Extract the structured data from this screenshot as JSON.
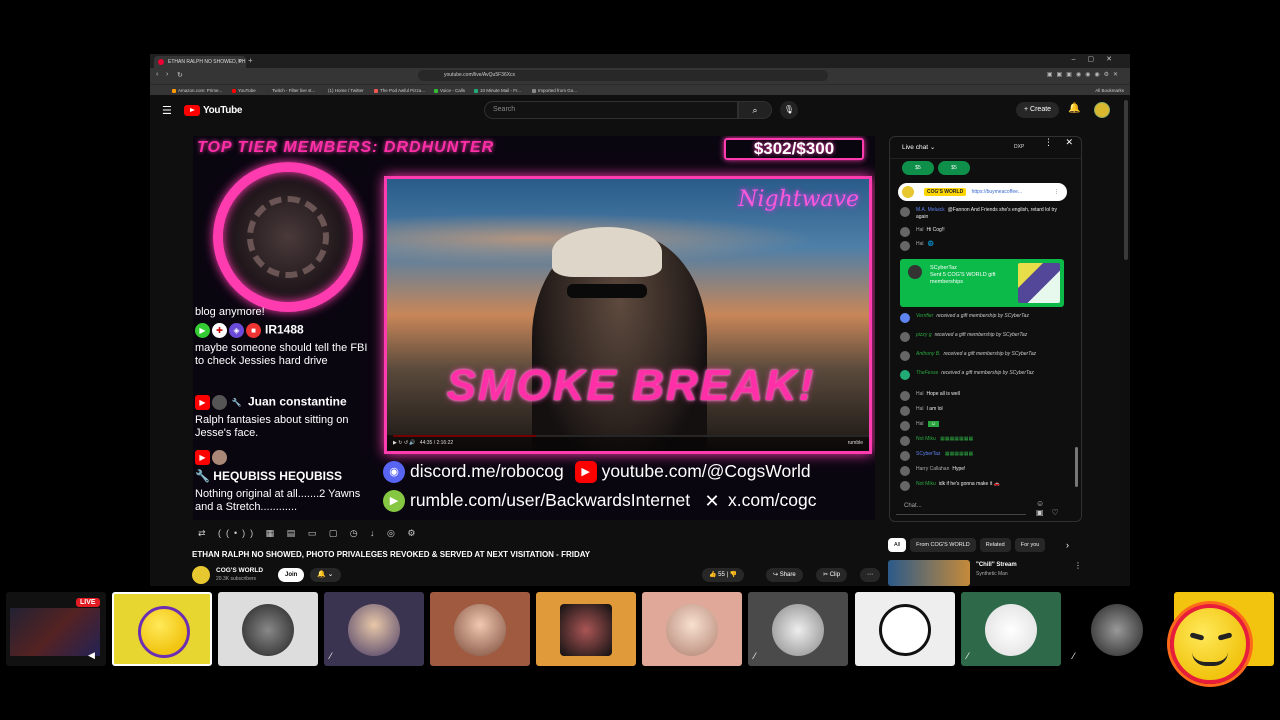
{
  "browser": {
    "tab_title": "ETHAN RALPH NO SHOWED, PH",
    "url": "youtube.com/live/AvQu5F36Xcs",
    "bookmarks": [
      "Amazon.com: Prime...",
      "YouTube",
      "Twitch - Filter live st...",
      "(1) Home / Twitter",
      "The Pod Awful Pizza...",
      "Voice - Calls",
      "10 Minute Mail - Fr...",
      "Imported from Go..."
    ],
    "all_bookmarks": "All Bookmarks"
  },
  "youtube": {
    "logo_text": "YouTube",
    "search_placeholder": "Search",
    "create_label": "Create"
  },
  "video": {
    "top_tier": "TOP TIER MEMBERS: DRDHUNTER",
    "goal": "$302/$300",
    "nightwave": "Nightwave",
    "smoke_break": "SMOKE BREAK!",
    "inner_time": "44:35 / 2:16:22",
    "inner_brand": "rumble",
    "left_chat": {
      "line1": "blog anymore!",
      "user1": "IR1488",
      "msg1": "maybe someone should tell the FBI to check Jessies hard drive",
      "user2": "Juan constantine",
      "msg2": "Ralph fantasies about sitting on Jesse's face.",
      "user3": "HEQUBISS HEQUBISS",
      "msg3": "Nothing original at all.......2 Yawns and a Stretch............"
    },
    "links": {
      "discord": "discord.me/robocog",
      "youtube": "youtube.com/@CogsWorld",
      "rumble": "rumble.com/user/BackwardsInternet",
      "x": "x.com/cogc"
    }
  },
  "video_title": "ETHAN RALPH NO SHOWED, PHOTO PRIVALEGES REVOKED & SERVED AT NEXT VISITATION - FRIDAY",
  "channel": {
    "name": "COG'S WORLD",
    "subs": "20.3K subscribers",
    "join": "Join",
    "likes": "55",
    "share": "Share",
    "clip": "Clip"
  },
  "chat": {
    "title": "Live chat",
    "dxp": "DXP",
    "donors": [
      "$5",
      "$5"
    ],
    "pinned_tag": "COG'S WORLD",
    "pinned_link": "https://buymeacoffee...",
    "messages_top": [
      {
        "author": "M.A. Meluick",
        "text": "@Fannon And Friends she's english, retard lol try again"
      },
      {
        "author": "Hal",
        "text": "Hi Cog!!"
      },
      {
        "author": "Hal",
        "text": ""
      }
    ],
    "gift_author": "SCyberTaz",
    "gift_text": "Sent 5 COG'S WORLD gift memberships",
    "messages_bottom": [
      {
        "author": "Verrifier",
        "text": "received a gift membership by SCyberTaz"
      },
      {
        "author": "pizzy g",
        "text": "received a gift membership by SCyberTaz"
      },
      {
        "author": "Anthony B.",
        "text": "received a gift membership by SCyberTaz"
      },
      {
        "author": "TheFesse",
        "text": "received a gift membership by SCyberTaz"
      },
      {
        "author": "Hal",
        "text": "Hope all is well"
      },
      {
        "author": "Hal",
        "text": "I am lol"
      },
      {
        "author": "Hal",
        "text": ""
      },
      {
        "author": "Not Miku",
        "text": ""
      },
      {
        "author": "SCyberTaz",
        "text": ""
      },
      {
        "author": "Harry Callahan",
        "text": "Hype!"
      },
      {
        "author": "Not Miku",
        "text": "idk if he's gonna make it"
      }
    ],
    "input_placeholder": "Chat..."
  },
  "chips": [
    "All",
    "From COG'S WORLD",
    "Related",
    "For you"
  ],
  "recommendation": {
    "title": "\"Chill\" Stream",
    "channel": "Synthetic Man"
  },
  "strip": {
    "live_badge": "LIVE"
  },
  "colors": {
    "neon_pink": "#ff3bb0",
    "youtube_red": "#ff0000",
    "gift_green": "#0cba4a"
  }
}
